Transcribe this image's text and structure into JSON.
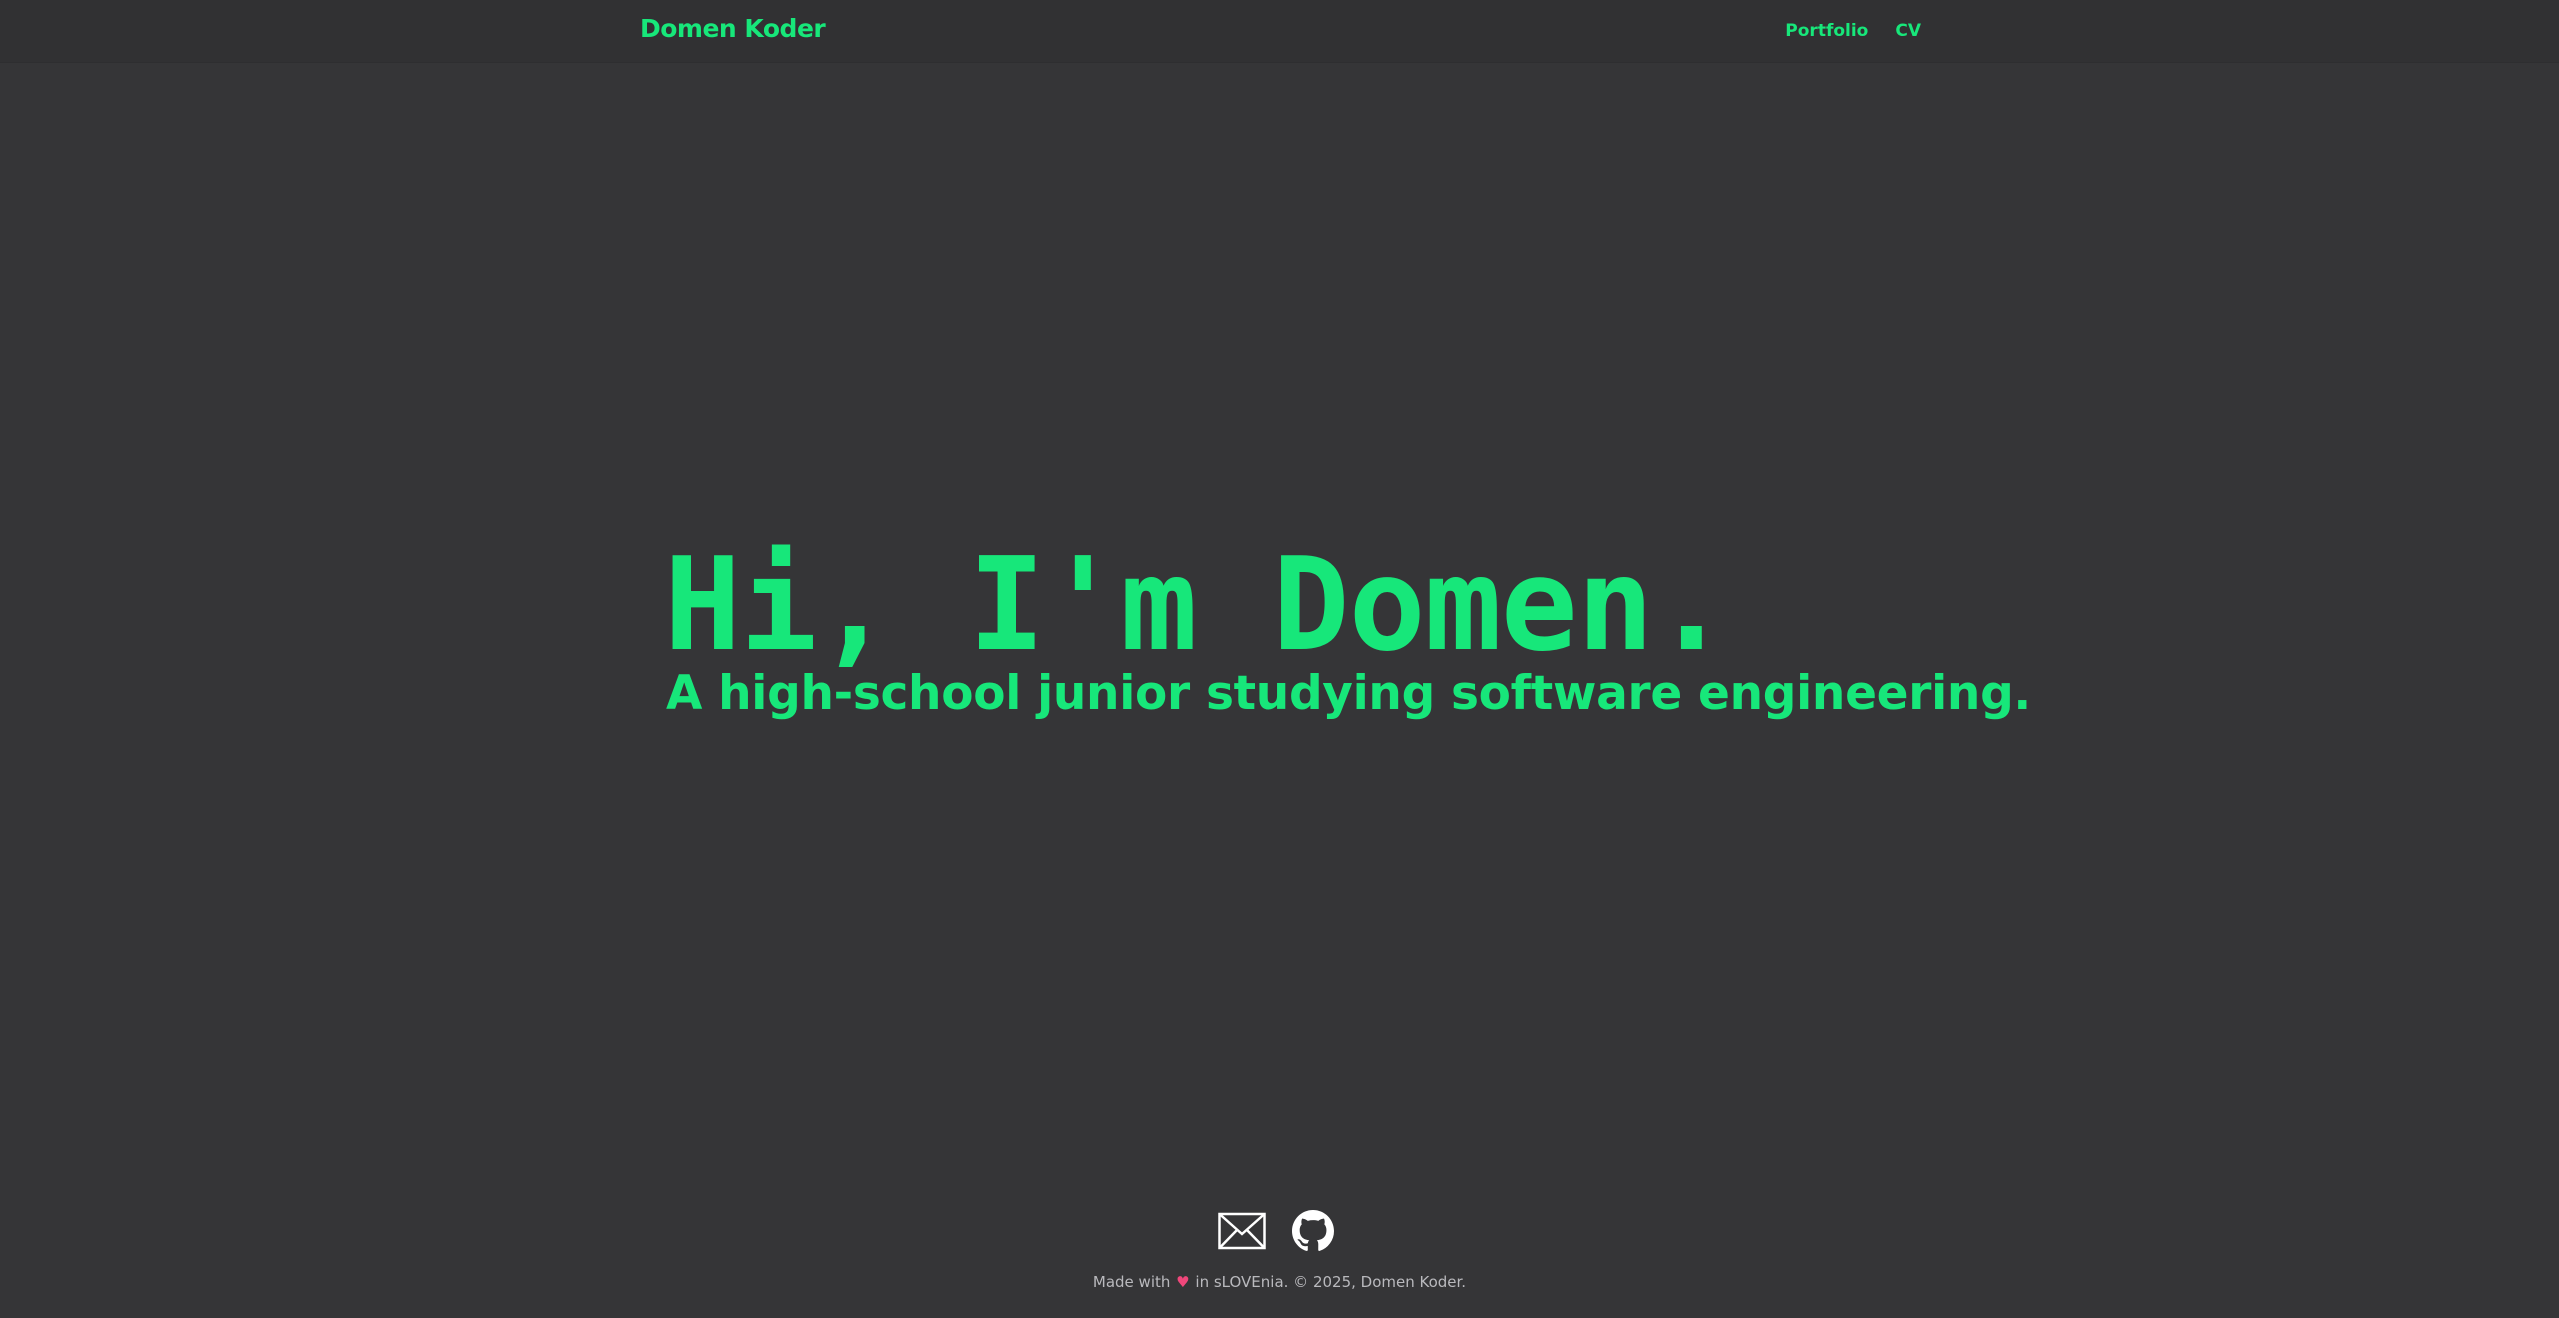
{
  "nav": {
    "brand": "Domen Koder",
    "links": [
      {
        "label": "Portfolio"
      },
      {
        "label": "CV"
      }
    ]
  },
  "hero": {
    "title": "Hi, I'm Domen.",
    "subtitle": "A high-school junior studying software engineering."
  },
  "footer": {
    "icons": [
      "mail-icon",
      "github-icon"
    ],
    "made_with": "Made with",
    "heart": "♥",
    "rest": "in sLOVEnia. © 2025, Domen Koder."
  },
  "colors": {
    "background": "#353537",
    "navbar": "#313133",
    "accent": "#17e77a",
    "footer_text": "#b9b9bd",
    "heart": "#f0477b"
  }
}
